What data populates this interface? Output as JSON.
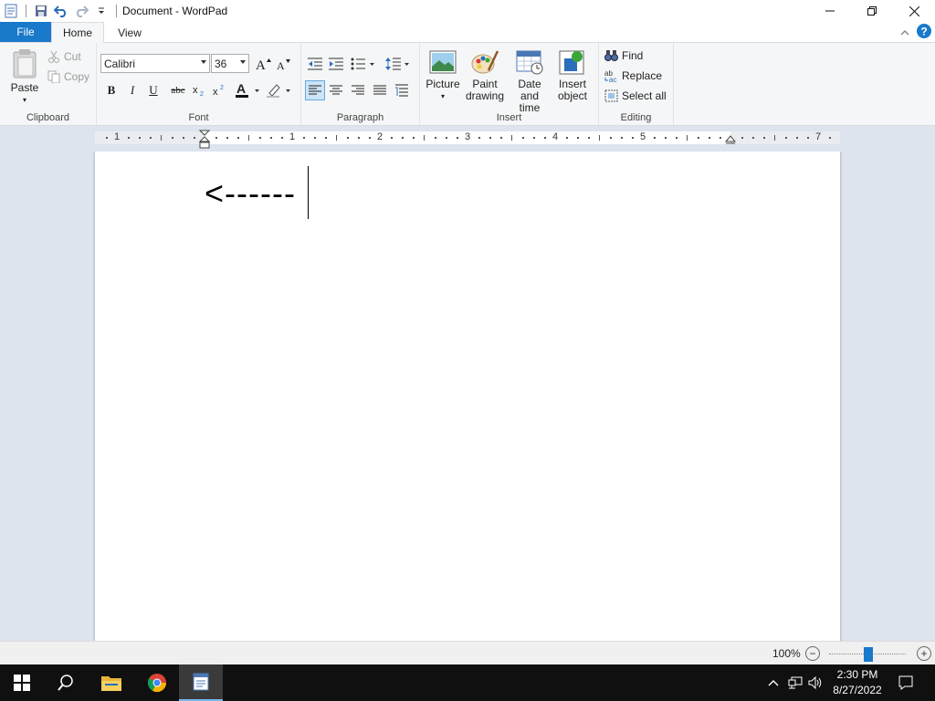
{
  "window": {
    "title": "Document - WordPad"
  },
  "tabs": {
    "file": "File",
    "home": "Home",
    "view": "View"
  },
  "ribbon": {
    "clipboard": {
      "label": "Clipboard",
      "paste": "Paste",
      "cut": "Cut",
      "copy": "Copy"
    },
    "font": {
      "label": "Font",
      "family": "Calibri",
      "size": "36"
    },
    "paragraph": {
      "label": "Paragraph"
    },
    "insert": {
      "label": "Insert",
      "picture": "Picture",
      "paint_1": "Paint",
      "paint_2": "drawing",
      "datetime_1": "Date and",
      "datetime_2": "time",
      "object_1": "Insert",
      "object_2": "object"
    },
    "editing": {
      "label": "Editing",
      "find": "Find",
      "replace": "Replace",
      "select_all": "Select all"
    }
  },
  "ruler": {
    "numbers": [
      "1",
      "1",
      "2",
      "3",
      "4",
      "5",
      "7"
    ]
  },
  "document": {
    "text": "<------"
  },
  "status": {
    "zoom": "100%",
    "zoom_out": "−",
    "zoom_in": "+"
  },
  "taskbar": {
    "time": "2:30 PM",
    "date": "8/27/2022"
  },
  "colors": {
    "accent": "#1979ca",
    "taskbar": "#101010",
    "workspace": "#dde4ee"
  }
}
